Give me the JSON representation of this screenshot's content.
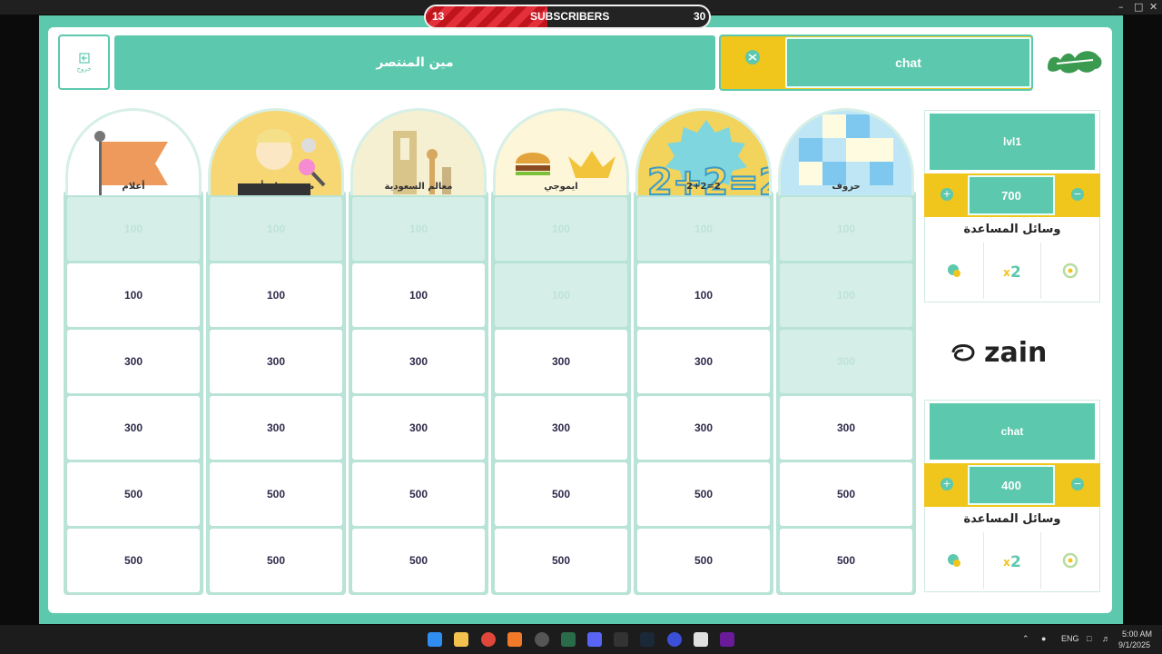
{
  "subscribers": {
    "current": "13",
    "label": "SUBSCRIBERS",
    "goal": "30",
    "progress": 0.43
  },
  "header": {
    "exit_label": "خروج",
    "winner_label": "مين المنتصر",
    "turn_team": "chat"
  },
  "categories": [
    {
      "name": "أعلام",
      "icon": "flag-icon"
    },
    {
      "name": "صوت فنان أجنبي",
      "icon": "singer-icon"
    },
    {
      "name": "معالم السعودية",
      "icon": "landmarks-icon"
    },
    {
      "name": "ايموجي",
      "icon": "emoji-icon"
    },
    {
      "name": "2+2=2",
      "icon": "math-icon"
    },
    {
      "name": "حروف",
      "icon": "letters-icon"
    }
  ],
  "board": {
    "rows": [
      [
        {
          "v": "100",
          "used": true
        },
        {
          "v": "100",
          "used": true
        },
        {
          "v": "100",
          "used": true
        },
        {
          "v": "100",
          "used": true
        },
        {
          "v": "100",
          "used": true
        },
        {
          "v": "100",
          "used": true
        }
      ],
      [
        {
          "v": "100",
          "used": false
        },
        {
          "v": "100",
          "used": false
        },
        {
          "v": "100",
          "used": false
        },
        {
          "v": "100",
          "used": true
        },
        {
          "v": "100",
          "used": false
        },
        {
          "v": "100",
          "used": true
        }
      ],
      [
        {
          "v": "300",
          "used": false
        },
        {
          "v": "300",
          "used": false
        },
        {
          "v": "300",
          "used": false
        },
        {
          "v": "300",
          "used": false
        },
        {
          "v": "300",
          "used": false
        },
        {
          "v": "300",
          "used": true
        }
      ],
      [
        {
          "v": "300",
          "used": false
        },
        {
          "v": "300",
          "used": false
        },
        {
          "v": "300",
          "used": false
        },
        {
          "v": "300",
          "used": false
        },
        {
          "v": "300",
          "used": false
        },
        {
          "v": "300",
          "used": false
        }
      ],
      [
        {
          "v": "500",
          "used": false
        },
        {
          "v": "500",
          "used": false
        },
        {
          "v": "500",
          "used": false
        },
        {
          "v": "500",
          "used": false
        },
        {
          "v": "500",
          "used": false
        },
        {
          "v": "500",
          "used": false
        }
      ],
      [
        {
          "v": "500",
          "used": false
        },
        {
          "v": "500",
          "used": false
        },
        {
          "v": "500",
          "used": false
        },
        {
          "v": "500",
          "used": false
        },
        {
          "v": "500",
          "used": false
        },
        {
          "v": "500",
          "used": false
        }
      ]
    ]
  },
  "teams": [
    {
      "name": "lvl1",
      "score": "700",
      "aids_title": "وسائل المساعدة",
      "aids": [
        "call-friend-icon",
        "double-icon",
        "skip-icon"
      ]
    },
    {
      "name": "chat",
      "score": "400",
      "aids_title": "وسائل المساعدة",
      "aids": [
        "call-friend-icon",
        "double-icon",
        "skip-icon"
      ]
    }
  ],
  "sponsor": "zain",
  "colors": {
    "accent": "#5cc8ad",
    "gold": "#f0c61c",
    "used": "#d5efe8",
    "red": "#c0141c"
  },
  "tray": {
    "lang": "ENG",
    "time": "5:00 AM",
    "date": "9/1/2025"
  }
}
